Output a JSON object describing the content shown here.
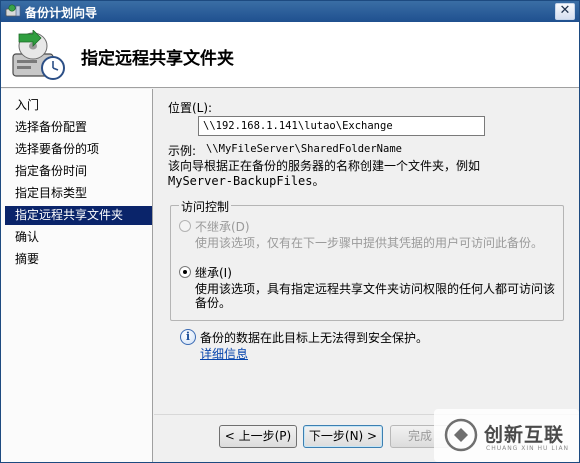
{
  "window": {
    "title": "备份计划向导",
    "close_glyph": "✕"
  },
  "header": {
    "page_title": "指定远程共享文件夹",
    "icon": "backup-wizard-icon"
  },
  "sidebar": {
    "items": [
      {
        "label": "入门"
      },
      {
        "label": "选择备份配置"
      },
      {
        "label": "选择要备份的项"
      },
      {
        "label": "指定备份时间"
      },
      {
        "label": "指定目标类型"
      },
      {
        "label": "指定远程共享文件夹",
        "active": true
      },
      {
        "label": "确认"
      },
      {
        "label": "摘要"
      }
    ]
  },
  "location": {
    "label": "位置(L):",
    "value": "\\\\192.168.1.141\\lutao\\Exchange",
    "example_label": "示例:",
    "example_value": "\\\\MyFileServer\\SharedFolderName",
    "note_line1": "该向导根据正在备份的服务器的名称创建一个文件夹，例如",
    "note_line2": "MyServer-BackupFiles。"
  },
  "access_control": {
    "title": "访问控制",
    "options": [
      {
        "label": "不继承(D)",
        "description": "使用该选项，仅有在下一步骤中提供其凭据的用户可访问此备份。",
        "selected": false,
        "enabled": false
      },
      {
        "label": "继承(I)",
        "description_line1": "使用该选项，具有指定远程共享文件夹访问权限的任何人都可访问该",
        "description_line2": "备份。",
        "selected": true,
        "enabled": true
      }
    ]
  },
  "info": {
    "icon": "info-icon",
    "text": "备份的数据在此目标上无法得到安全保护。",
    "link": "详细信息"
  },
  "footer": {
    "back_label": "< 上一步(P)",
    "next_label": "下一步(N) >",
    "finish_label": "完成"
  },
  "watermark": {
    "text": "创新互联",
    "sub": "CHUANG XIN HU LIAN"
  }
}
